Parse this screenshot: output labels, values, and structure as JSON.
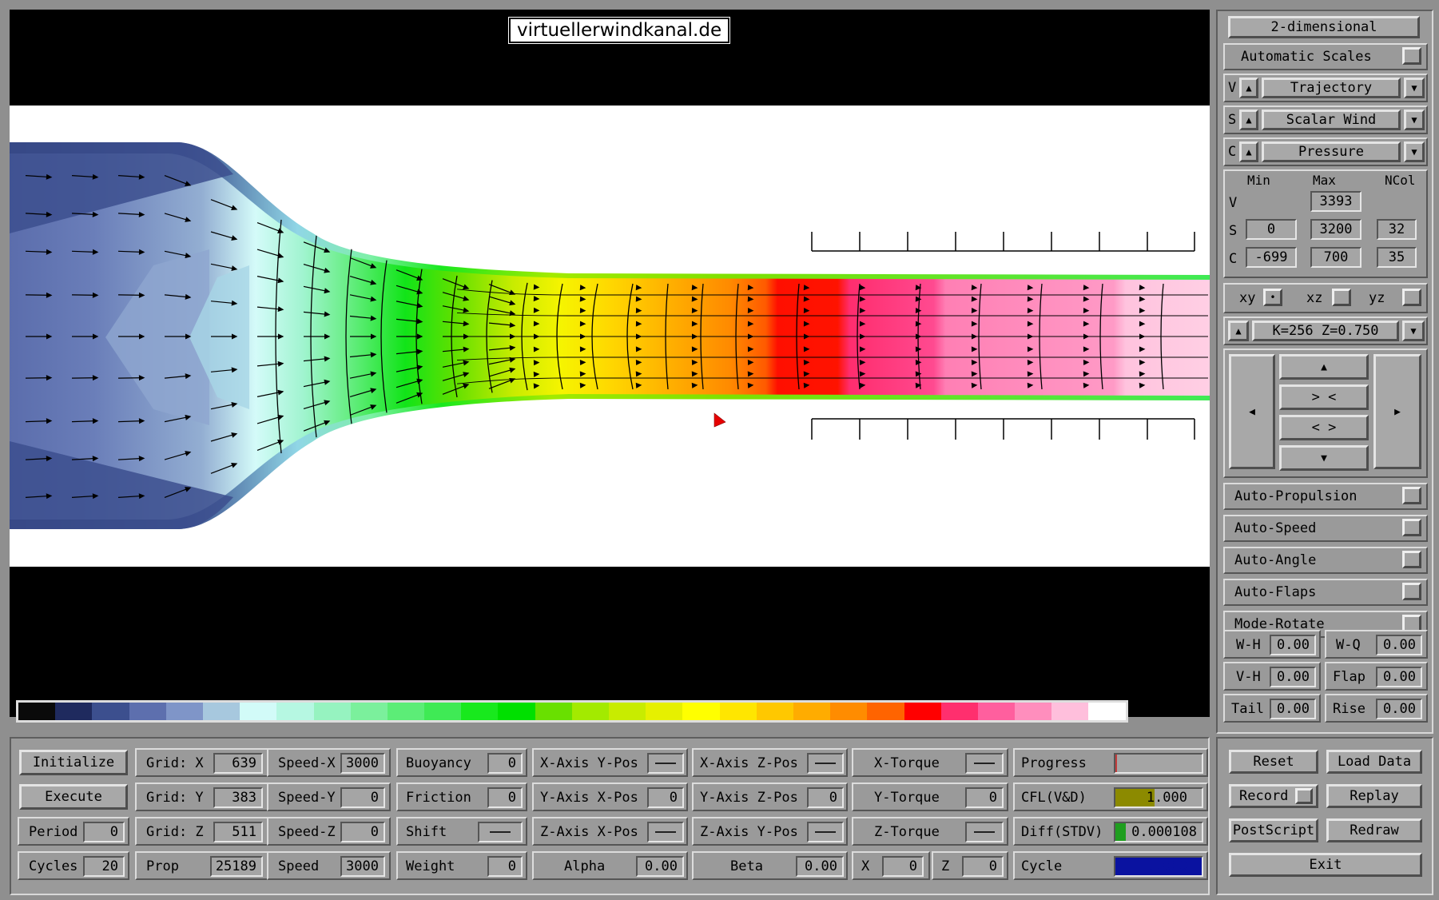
{
  "title": "virtuellerwindkanal.de",
  "colorbar": [
    "#0a0a0a",
    "#1f2a5e",
    "#3c4f8e",
    "#5d6fae",
    "#7f95c8",
    "#a7c8de",
    "#d2fbf8",
    "#b6f7e2",
    "#96f3c0",
    "#7bf09c",
    "#5ced77",
    "#3fea55",
    "#18e91d",
    "#00e000",
    "#69e000",
    "#a3ea00",
    "#c8ec00",
    "#e6f000",
    "#ffff00",
    "#ffe600",
    "#ffc800",
    "#ffac00",
    "#ff8c00",
    "#ff6400",
    "#ff0000",
    "#ff2f6e",
    "#ff5f9e",
    "#ff8ebd",
    "#ffbfdc",
    "#ffffff"
  ],
  "sidebar": {
    "dimension_button": "2-dimensional",
    "automatic_scales": "Automatic Scales",
    "v_row": {
      "tag": "V",
      "value": "Trajectory"
    },
    "s_row": {
      "tag": "S",
      "value": "Scalar Wind"
    },
    "c_row": {
      "tag": "C",
      "value": "Pressure"
    },
    "scale_headers": {
      "min": "Min",
      "max": "Max",
      "ncol": "NCol"
    },
    "scale_v": {
      "tag": "V",
      "max": "3393"
    },
    "scale_s": {
      "tag": "S",
      "min": "0",
      "max": "3200",
      "ncol": "32"
    },
    "scale_c": {
      "tag": "C",
      "min": "-699",
      "max": "700",
      "ncol": "35"
    },
    "planes": {
      "xy": "xy",
      "xz": "xz",
      "yz": "yz",
      "xy_mark": "•"
    },
    "slice_label": "K=256  Z=0.750",
    "nav": {
      "up": "▲",
      "down": "▼",
      "left": "◀",
      "right": "▶",
      "zoom_in": "> <",
      "zoom_out": "< >"
    },
    "toggles": [
      "Auto-Propulsion",
      "Auto-Speed",
      "Auto-Angle",
      "Auto-Flaps",
      "Mode-Rotate"
    ],
    "params": [
      {
        "label": "W-H",
        "value": "0.00"
      },
      {
        "label": "W-Q",
        "value": "0.00"
      },
      {
        "label": "V-H",
        "value": "0.00"
      },
      {
        "label": "Flap",
        "value": "0.00"
      },
      {
        "label": "Tail",
        "value": "0.00"
      },
      {
        "label": "Rise",
        "value": "0.00"
      }
    ]
  },
  "bottom": {
    "initialize": "Initialize",
    "execute": "Execute",
    "period": {
      "label": "Period",
      "value": "0"
    },
    "cycles": {
      "label": "Cycles",
      "value": "20"
    },
    "grid_x": {
      "label": "Grid: X",
      "value": "639"
    },
    "grid_y": {
      "label": "Grid: Y",
      "value": "383"
    },
    "grid_z": {
      "label": "Grid: Z",
      "value": "511"
    },
    "prop": {
      "label": "Prop",
      "value": "25189"
    },
    "speed_x": {
      "label": "Speed-X",
      "value": "3000"
    },
    "speed_y": {
      "label": "Speed-Y",
      "value": "0"
    },
    "speed_z": {
      "label": "Speed-Z",
      "value": "0"
    },
    "speed": {
      "label": "Speed",
      "value": "3000"
    },
    "buoyancy": {
      "label": "Buoyancy",
      "value": "0"
    },
    "friction": {
      "label": "Friction",
      "value": "0"
    },
    "shift": {
      "label": "Shift"
    },
    "weight": {
      "label": "Weight",
      "value": "0"
    },
    "x_axis_y_pos": {
      "label": "X-Axis Y-Pos"
    },
    "y_axis_x_pos": {
      "label": "Y-Axis X-Pos",
      "value": "0"
    },
    "z_axis_x_pos": {
      "label": "Z-Axis X-Pos"
    },
    "alpha": {
      "label": "Alpha",
      "value": "0.00"
    },
    "x_axis_z_pos": {
      "label": "X-Axis Z-Pos"
    },
    "y_axis_z_pos": {
      "label": "Y-Axis Z-Pos",
      "value": "0"
    },
    "z_axis_y_pos": {
      "label": "Z-Axis Y-Pos"
    },
    "beta": {
      "label": "Beta",
      "value": "0.00"
    },
    "x_torque": {
      "label": "X-Torque"
    },
    "y_torque": {
      "label": "Y-Torque",
      "value": "0"
    },
    "z_torque": {
      "label": "Z-Torque"
    },
    "x_small": {
      "label": "X",
      "value": "0"
    },
    "z_small": {
      "label": "Z",
      "value": "0"
    },
    "progress": {
      "label": "Progress",
      "fraction": 0.02
    },
    "cfl": {
      "label": "CFL(V&D)",
      "value": "1.000",
      "color": "#8c8a00"
    },
    "diff": {
      "label": "Diff(STDV)",
      "value": "0.000108",
      "color": "#1e9e1e"
    },
    "cycle": {
      "label": "Cycle",
      "value": "1.000",
      "color": "#0a12a0"
    },
    "reset": "Reset",
    "load_data": "Load Data",
    "record": "Record",
    "replay": "Replay",
    "postscript": "PostScript",
    "redraw": "Redraw",
    "exit": "Exit"
  }
}
